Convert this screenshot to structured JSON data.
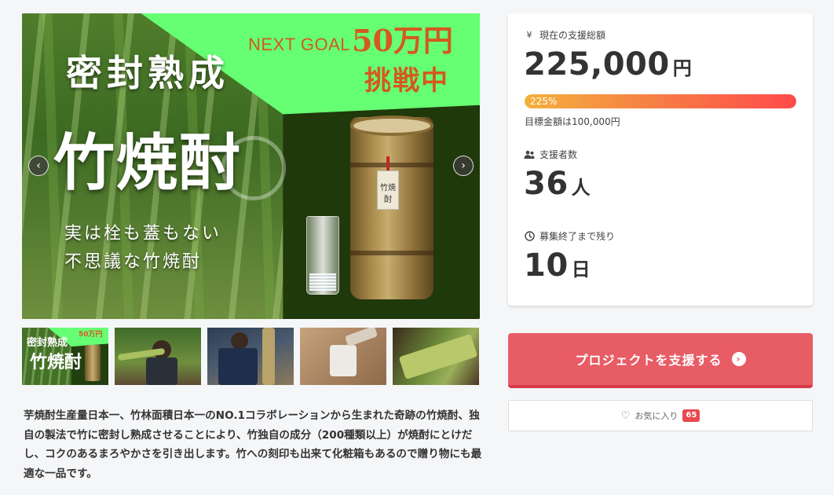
{
  "main_visual": {
    "goal_en": "NEXT GOAL",
    "goal_amount": "50万円",
    "goal_challenge": "挑戦中",
    "title_small": "密封熟成",
    "title_big": "竹焼酎",
    "sub_line1": "実は栓も蓋もない",
    "sub_line2": "不思議な竹焼酎",
    "tag_text": "竹焼酎",
    "prev_arrow": "‹",
    "next_arrow": "›"
  },
  "thumbnail": {
    "goal": "50万円",
    "title_small": "密封熟成",
    "title_big": "竹焼酎"
  },
  "description": "芋焼酎生産量日本一、竹林面積日本一のNO.1コラボレーションから生まれた奇跡の竹焼酎、独自の製法で竹に密封し熟成させることにより、竹独自の成分（200種類以上）が焼酎にとけだし、コクのあるまろやかさを引き出します。竹への刻印も出来て化粧箱もあるので贈り物にも最適な一品です。",
  "stats": {
    "total_label": "現在の支援総額",
    "total_icon": "¥",
    "total_amount": "225,000",
    "total_unit": "円",
    "progress_percent": 225,
    "progress_text": "225%",
    "goal_text": "目標金額は100,000円",
    "supporters_label": "支援者数",
    "supporters_count": "36",
    "supporters_unit": "人",
    "remaining_label": "募集終了まで残り",
    "remaining_days": "10",
    "remaining_unit": "日"
  },
  "actions": {
    "support_label": "プロジェクトを支援する",
    "favorite_label": "お気に入り",
    "favorite_count": "65"
  },
  "colors": {
    "support_button": "#e85c66",
    "progress_start": "#f3b03c",
    "progress_end": "#ff4a4a",
    "badge": "#e8484e"
  }
}
